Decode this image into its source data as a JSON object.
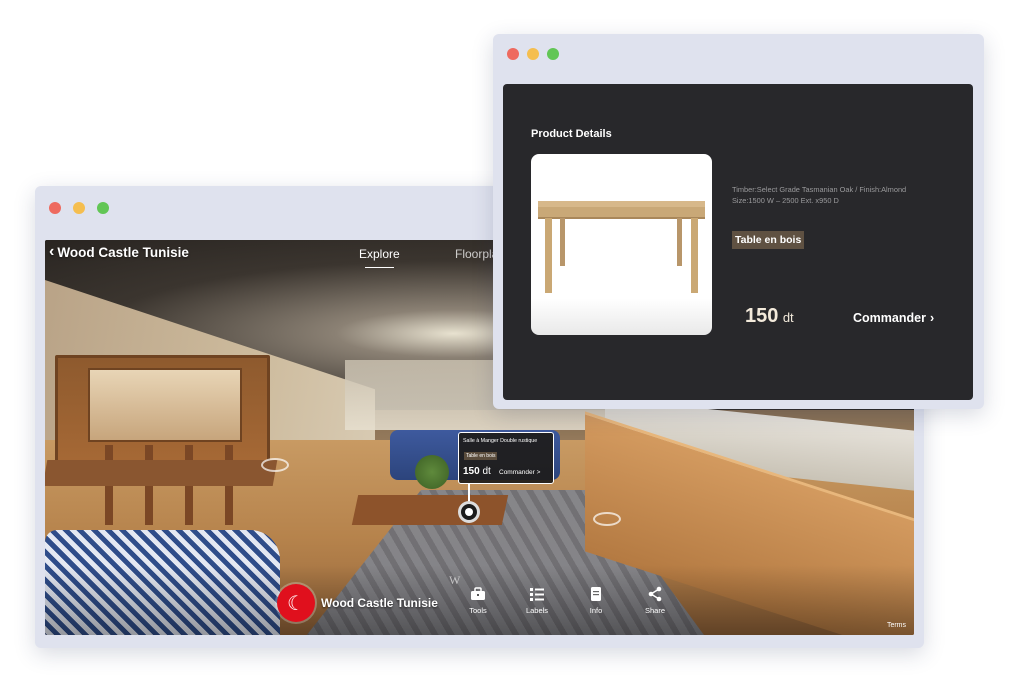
{
  "tour": {
    "title": "Wood Castle Tunisie",
    "tabs": [
      "Explore",
      "Floorplan"
    ],
    "hotspot": {
      "name": "Salle à Manger Double rustique",
      "tag": "Table en bois",
      "price_value": "150",
      "price_unit": "dt",
      "order_label": "Commander >"
    },
    "brand_name": "Wood Castle Tunisie",
    "brand_logo_glyph": "☾",
    "compass_letter": "W",
    "tools": [
      {
        "label": "Tools",
        "icon": "toolbox-icon"
      },
      {
        "label": "Labels",
        "icon": "list-icon"
      },
      {
        "label": "Info",
        "icon": "document-icon"
      },
      {
        "label": "Share",
        "icon": "share-icon"
      }
    ],
    "terms": "Terms"
  },
  "product": {
    "heading": "Product Details",
    "specs": "Timber:Select Grade Tasmanian Oak / Finish:Almond Size:1500 W – 2500 Ext. x950 D",
    "tag": "Table en bois",
    "price_value": "150",
    "price_unit": "dt",
    "order_label": "Commander",
    "order_chevron": "›"
  },
  "colors": {
    "window_frame": "#dfe2ee",
    "panel_dark": "#28282b",
    "tag_brown": "#5f5142",
    "brand_red": "#e0101d",
    "close_dot": "#ee6a5f",
    "minimize_dot": "#f5be4f",
    "maximize_dot": "#62c655"
  }
}
